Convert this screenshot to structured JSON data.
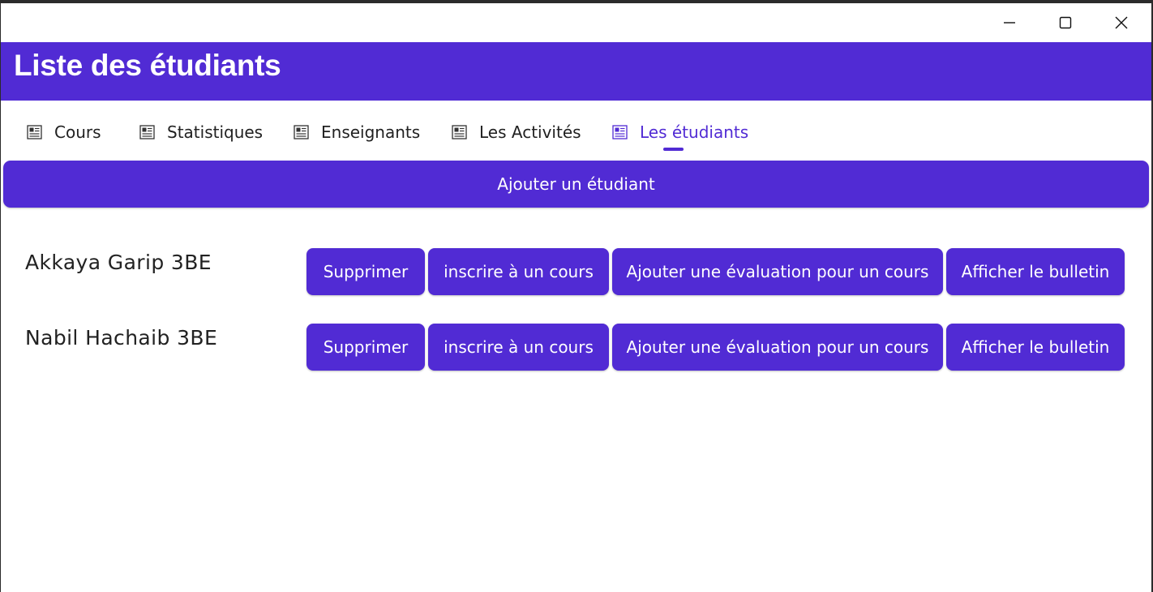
{
  "window": {
    "controls": {
      "minimize": "minimize-icon",
      "maximize": "maximize-icon",
      "close": "close-icon"
    }
  },
  "header": {
    "title": "Liste des étudiants",
    "background": "#512bd4"
  },
  "tabs": [
    {
      "label": "Cours",
      "icon": "page-icon"
    },
    {
      "label": "Statistiques",
      "icon": "page-icon"
    },
    {
      "label": "Enseignants",
      "icon": "page-icon"
    },
    {
      "label": "Les Activités",
      "icon": "page-icon"
    },
    {
      "label": "Les étudiants",
      "icon": "page-icon",
      "selected": true
    }
  ],
  "add_button": {
    "label": "Ajouter un étudiant"
  },
  "students": [
    {
      "name": "Akkaya Garip 3BE",
      "actions": {
        "delete": "Supprimer",
        "enroll": "inscrire à un cours",
        "evaluate": "Ajouter une évaluation pour un cours",
        "bulletin": "Afficher le bulletin"
      }
    },
    {
      "name": "Nabil Hachaib 3BE",
      "actions": {
        "delete": "Supprimer",
        "enroll": "inscrire à un cours",
        "evaluate": "Ajouter une évaluation pour un cours",
        "bulletin": "Afficher le bulletin"
      }
    }
  ],
  "colors": {
    "accent": "#512bd4",
    "text": "#212121",
    "background": "#ffffff"
  }
}
